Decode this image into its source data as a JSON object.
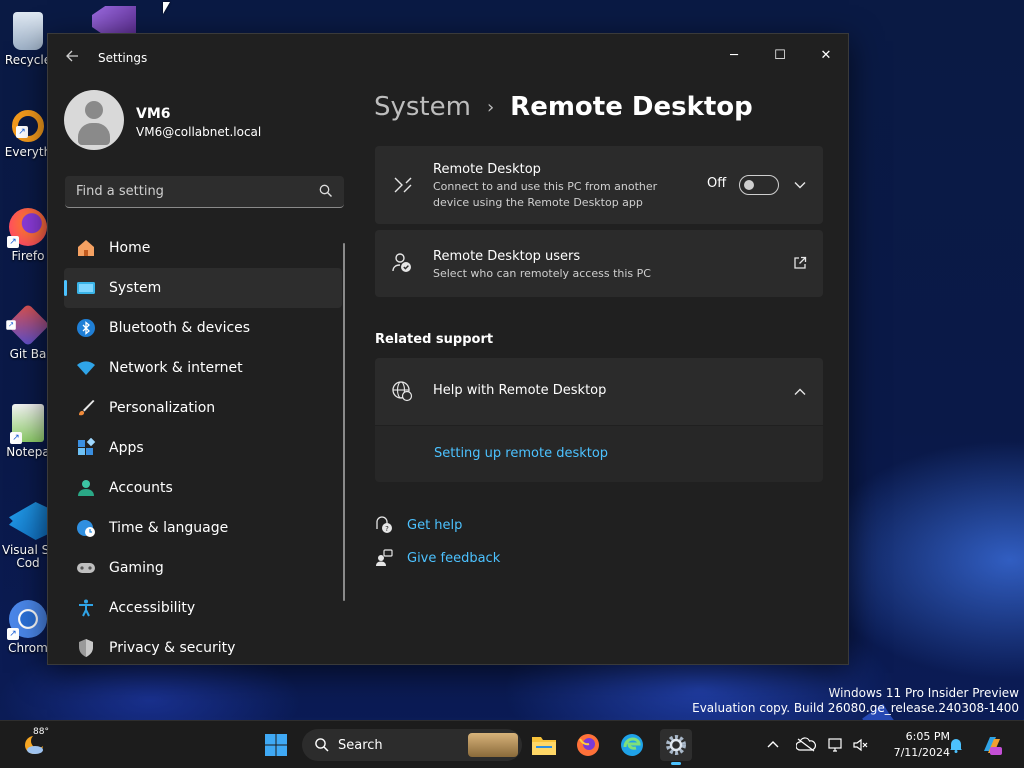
{
  "desktop": {
    "icons": [
      {
        "label": "Recycle"
      },
      {
        "label": "Everyth"
      },
      {
        "label": "Firefo"
      },
      {
        "label": "Git Ba"
      },
      {
        "label": "Notepa"
      },
      {
        "label": "Visual St\nCod"
      },
      {
        "label": "Chrom"
      }
    ],
    "watermark_line1": "Windows 11 Pro Insider Preview",
    "watermark_line2": "Evaluation copy. Build 26080.ge_release.240308-1400"
  },
  "window": {
    "title": "Settings",
    "minimize_glyph": "─",
    "maximize_glyph": "☐",
    "close_glyph": "✕"
  },
  "profile": {
    "name": "VM6",
    "email": "VM6@collabnet.local"
  },
  "search": {
    "placeholder": "Find a setting"
  },
  "nav": {
    "items": [
      {
        "label": "Home",
        "icon": "home-icon"
      },
      {
        "label": "System",
        "icon": "system-icon"
      },
      {
        "label": "Bluetooth & devices",
        "icon": "bluetooth-icon"
      },
      {
        "label": "Network & internet",
        "icon": "wifi-icon"
      },
      {
        "label": "Personalization",
        "icon": "brush-icon"
      },
      {
        "label": "Apps",
        "icon": "apps-icon"
      },
      {
        "label": "Accounts",
        "icon": "accounts-icon"
      },
      {
        "label": "Time & language",
        "icon": "globe-clock-icon"
      },
      {
        "label": "Gaming",
        "icon": "gamepad-icon"
      },
      {
        "label": "Accessibility",
        "icon": "accessibility-icon"
      },
      {
        "label": "Privacy & security",
        "icon": "shield-icon"
      }
    ],
    "active_index": 1
  },
  "breadcrumb": {
    "parent": "System",
    "separator": "›",
    "current": "Remote Desktop"
  },
  "remote_desktop": {
    "title": "Remote Desktop",
    "description": "Connect to and use this PC from another device using the Remote Desktop app",
    "toggle_state": "Off",
    "enabled": false
  },
  "remote_users": {
    "title": "Remote Desktop users",
    "description": "Select who can remotely access this PC"
  },
  "related_support": {
    "heading": "Related support",
    "help_title": "Help with Remote Desktop",
    "help_link": "Setting up remote desktop"
  },
  "aux_links": {
    "get_help": "Get help",
    "give_feedback": "Give feedback"
  },
  "taskbar": {
    "weather_temp": "88°",
    "search_label": "Search",
    "clock_time": "6:05 PM",
    "clock_date": "7/11/2024"
  },
  "colors": {
    "accent": "#4cc2ff",
    "window_bg": "#202020",
    "card_bg": "#2b2b2b"
  }
}
